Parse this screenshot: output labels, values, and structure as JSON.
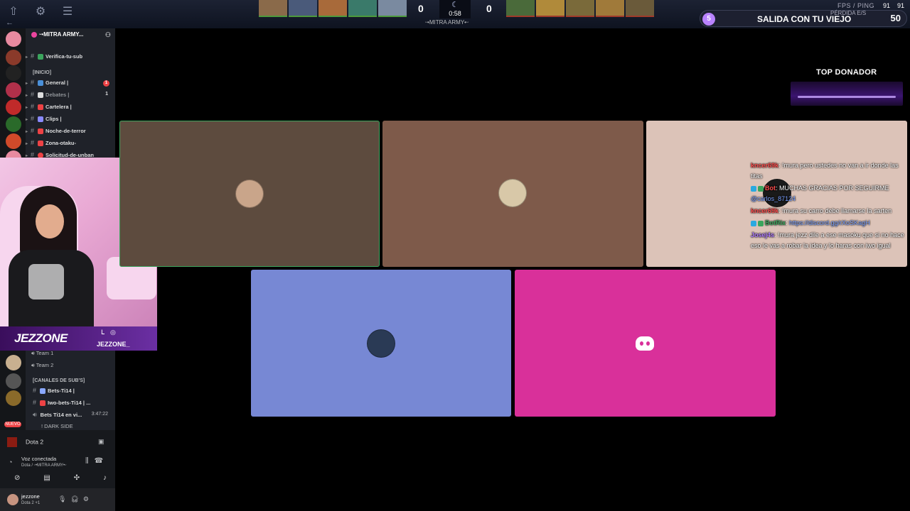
{
  "hud": {
    "score_radiant": "0",
    "score_dire": "0",
    "clock": "0:58",
    "server_name": "ᵕ•MITRA ARMY•ᵕ",
    "level": "5",
    "song_title": "SALIDA CON TU VIEJO",
    "song_count": "50",
    "fps_label": "FPS / PING",
    "fps": "91",
    "ping": "91",
    "loss_label": "PÉRDIDA E/S",
    "radiant_heroes": [
      "#8a6a4a",
      "#4a5a7a",
      "#a86a3a",
      "#3a7a6a",
      "#7a8aa0"
    ],
    "dire_heroes": [
      "#4a6a3a",
      "#b08a3a",
      "#7a6a3a",
      "#a07a3a",
      "#6a5a3a"
    ],
    "radiant_color": "#4c9a3c",
    "dire_color": "#a03a2a"
  },
  "sidebar": {
    "server_name": "ᵕ•MITRA ARMY...",
    "channels_top": [
      {
        "label": "Verifica-tu-sub",
        "color": "#3ba55d"
      }
    ],
    "category_inicio": "[INICIO]",
    "channels": [
      {
        "label": "General |",
        "color": "#4a90d9",
        "mention": "1"
      },
      {
        "label": "Debates |",
        "color": "#dcddde",
        "count": "1"
      },
      {
        "label": "Cartelera |",
        "color": "#ed4245"
      },
      {
        "label": "Clips |",
        "color": "#8a8aff"
      },
      {
        "label": "Noche-de-terror",
        "color": "#ed4245"
      },
      {
        "label": "Zona-otaku-",
        "color": "#ed4245"
      },
      {
        "label": "Solicitud-de-unban",
        "color": "#ed4245"
      }
    ],
    "voice_channels": [
      {
        "label": "Team 1"
      },
      {
        "label": "Team 2"
      }
    ],
    "category_subs": "[CANALES DE SUB'S]",
    "sub_channels": [
      {
        "label": "Bets-Ti14 |"
      },
      {
        "label": "Iwo-bets-Ti14 | ..."
      },
      {
        "label": "Bets Ti14 en vi...",
        "time": "3:47:22"
      }
    ],
    "dark_side": "! DARK SIDE",
    "new_badge": "NUEVO",
    "game": "Dota 2",
    "voice_status": "Voz conectada",
    "voice_sub": "Dota / ᵕ•MITRA ARMY•ᵕ",
    "username": "jezzone",
    "user_status": "Dota 2 +1"
  },
  "webcam": {
    "brand": "JEZZONE",
    "handle": "JEZZONE_"
  },
  "donor": {
    "title": "TOP DONADOR"
  },
  "chat": [
    {
      "user": "kncer69k",
      "user_color": "#ff4d4d",
      "text": ": !mura pero ustedes no van a ir donde las titas"
    },
    {
      "user": "Bot",
      "user_color": "#ff4d4d",
      "text": ": MUCHAS GRACIAS POR SEGUIRME",
      "mention": "@carlos_87124",
      "badges": [
        "#2aa9e0",
        "#3ba55d"
      ]
    },
    {
      "user": "kncer69k",
      "user_color": "#ff4d4d",
      "text": ": !mura su carro debe llamarse la sarten"
    },
    {
      "user": "BotRix",
      "user_color": "#3ba55d",
      "text": ": ",
      "link": "https://discord.gg/rXoSKagH",
      "badges": [
        "#2aa9e0",
        "#3ba55d"
      ]
    },
    {
      "user": "Josej4s",
      "user_color": "#b07cff",
      "text": ": !mura jezz dile a ese masoku que si no hace eso le vas a robar la idea y lo haras con iwo igual"
    }
  ],
  "tiles": [
    {
      "avatar_color": "#c9a58a"
    },
    {
      "avatar_color": "#d8c8a8"
    },
    {
      "avatar_color": "#2a3a55"
    }
  ]
}
